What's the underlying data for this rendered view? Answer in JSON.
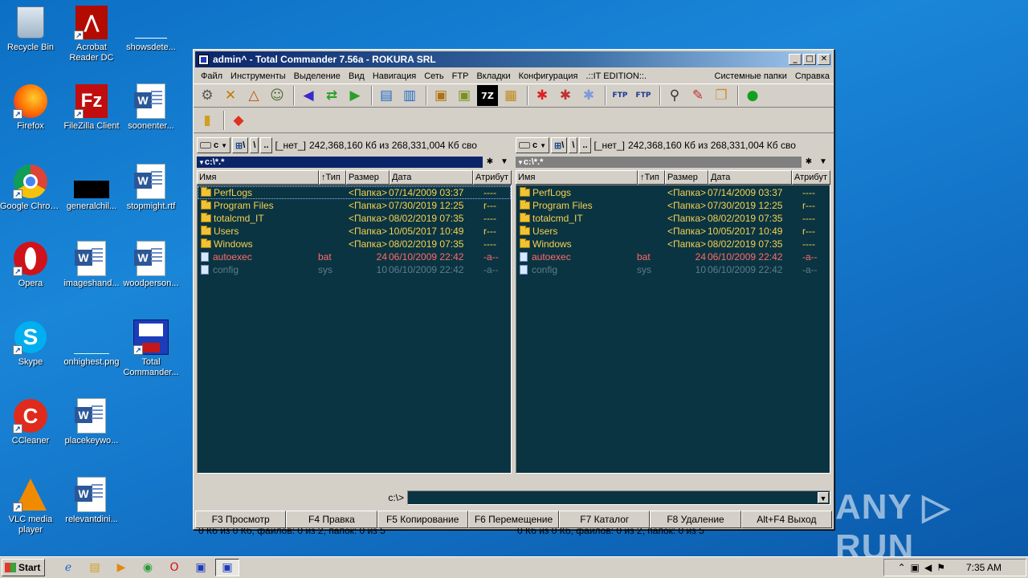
{
  "desktop": {
    "icons": [
      {
        "label": "Recycle Bin",
        "icon": "recycle-bin-icon"
      },
      {
        "label": "Acrobat Reader DC",
        "icon": "acrobat-icon"
      },
      {
        "label": "showsdete...",
        "icon": "blank-file-icon"
      },
      {
        "label": "Firefox",
        "icon": "firefox-icon"
      },
      {
        "label": "FileZilla Client",
        "icon": "filezilla-icon"
      },
      {
        "label": "soonenter...",
        "icon": "word-doc-icon"
      },
      {
        "label": "Google Chrome",
        "icon": "chrome-icon"
      },
      {
        "label": "generalchil...",
        "icon": "black-image-icon"
      },
      {
        "label": "stopmight.rtf",
        "icon": "word-doc-icon"
      },
      {
        "label": "Opera",
        "icon": "opera-icon"
      },
      {
        "label": "imageshand...",
        "icon": "word-doc-icon"
      },
      {
        "label": "woodperson...",
        "icon": "word-doc-icon"
      },
      {
        "label": "Skype",
        "icon": "skype-icon"
      },
      {
        "label": "onhighest.png",
        "icon": "blue-image-icon"
      },
      {
        "label": "Total Commander...",
        "icon": "floppy-icon"
      },
      {
        "label": "CCleaner",
        "icon": "ccleaner-icon"
      },
      {
        "label": "placekeywo...",
        "icon": "word-doc-icon"
      },
      {
        "label": "VLC media player",
        "icon": "vlc-icon"
      },
      {
        "label": "relevantdini...",
        "icon": "word-doc-icon"
      }
    ]
  },
  "window": {
    "title": "admin^ - Total Commander 7.56a - ROKURA SRL",
    "controls": {
      "minimize": "_",
      "maximize": "□",
      "close": "✕"
    },
    "menu": [
      "Файл",
      "Инструменты",
      "Выделение",
      "Вид",
      "Навигация",
      "Сеть",
      "FTP",
      "Вкладки",
      "Конфигурация",
      ".::IT EDITION::.",
      "Системные папки",
      "Справка"
    ]
  },
  "left_panel": {
    "drive_letter": "c",
    "net_label": "[_нет_]",
    "drive_info": "242,368,160 Кб из 268,331,004 Кб сво",
    "path": "c:\\*.*",
    "status": "0 Кб из 0 Кб, файлов: 0 из 2, папок: 0 из 5"
  },
  "right_panel": {
    "drive_letter": "c",
    "net_label": "[_нет_]",
    "drive_info": "242,368,160 Кб из 268,331,004 Кб сво",
    "path": "c:\\*.*",
    "status": "0 Кб из 0 Кб, файлов: 0 из 2, папок: 0 из 5"
  },
  "columns": {
    "name": "Имя",
    "ext": "↑Тип",
    "size": "Размер",
    "date": "Дата",
    "attr": "Атрибут"
  },
  "files": [
    {
      "name": "PerfLogs",
      "ext": "",
      "size": "<Папка>",
      "date": "07/14/2009 03:37",
      "attr": "----",
      "kind": "folder"
    },
    {
      "name": "Program Files",
      "ext": "",
      "size": "<Папка>",
      "date": "07/30/2019 12:25",
      "attr": "r---",
      "kind": "folder"
    },
    {
      "name": "totalcmd_IT",
      "ext": "",
      "size": "<Папка>",
      "date": "08/02/2019 07:35",
      "attr": "----",
      "kind": "folder"
    },
    {
      "name": "Users",
      "ext": "",
      "size": "<Папка>",
      "date": "10/05/2017 10:49",
      "attr": "r---",
      "kind": "folder"
    },
    {
      "name": "Windows",
      "ext": "",
      "size": "<Папка>",
      "date": "08/02/2019 07:35",
      "attr": "----",
      "kind": "folder"
    },
    {
      "name": "autoexec",
      "ext": "bat",
      "size": "24",
      "date": "06/10/2009 22:42",
      "attr": "-a--",
      "kind": "bat"
    },
    {
      "name": "config",
      "ext": "sys",
      "size": "10",
      "date": "06/10/2009 22:42",
      "attr": "-a--",
      "kind": "sys"
    }
  ],
  "cmdline": {
    "label": "c:\\>"
  },
  "fkeys": [
    "F3 Просмотр",
    "F4 Правка",
    "F5 Копирование",
    "F6 Перемещение",
    "F7 Каталог",
    "F8 Удаление",
    "Alt+F4 Выход"
  ],
  "taskbar": {
    "start": "Start",
    "clock": "7:35 AM"
  },
  "watermark": "ANY ▷ RUN",
  "colors": {
    "panel_bg": "#0b3442",
    "folder_text": "#f4d24f",
    "bat_text": "#ff6b6b",
    "sys_text": "#5b7e8a",
    "title_active": "#0a246a"
  }
}
